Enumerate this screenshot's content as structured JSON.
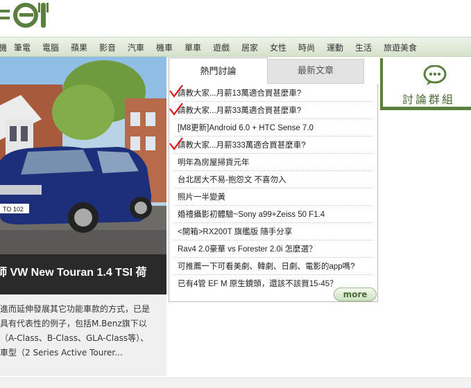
{
  "nav": {
    "items": [
      "機",
      "筆電",
      "電腦",
      "蘋果",
      "影音",
      "汽車",
      "機車",
      "單車",
      "遊戲",
      "居家",
      "女性",
      "時尚",
      "運動",
      "生活",
      "旅遊美食"
    ]
  },
  "hero": {
    "plate_text": "TO 102",
    "caption": "師 VW New Touran 1.4 TSI 荷",
    "excerpt": [
      "進而延伸發展其它功能車款的方式，已是",
      "具有代表性的例子，包括M.Benz旗下以",
      "（A-Class、B-Class、GLA-Class等）、",
      "車型（2 Series Active Tourer..."
    ]
  },
  "tabs": {
    "hot": "熱門討論",
    "latest": "最新文章"
  },
  "threads": [
    "請教大家...月薪13萬適合買甚麼車?",
    "請教大家...月薪33萬適合買甚麼車?",
    "[M8更新]Android 6.0 + HTC Sense 7.0",
    "請教大家...月薪333萬適合買甚麼車?",
    "明年為房屋掃貨元年",
    "台北居大不易-抱怨文 不喜勿入",
    "照片一半變黃",
    "婚禮攝影初體驗~Sony a99+Zeiss 50 F1.4",
    "<開箱>RX200T 旗艦版 隨手分享",
    "Rav4 2.0豪華 vs Forester 2.0i 怎麼選？",
    "可推薦一下可看美劇、韓劇、日劇、電影的app嗎?",
    "已有4管 EF M 原生鏡頭，還該不該買15-45？"
  ],
  "more_label": "more",
  "forum": {
    "label": "討論群組"
  },
  "colors": {
    "brand_green": "#5b7f3f",
    "annotation_red": "#e0141b"
  }
}
